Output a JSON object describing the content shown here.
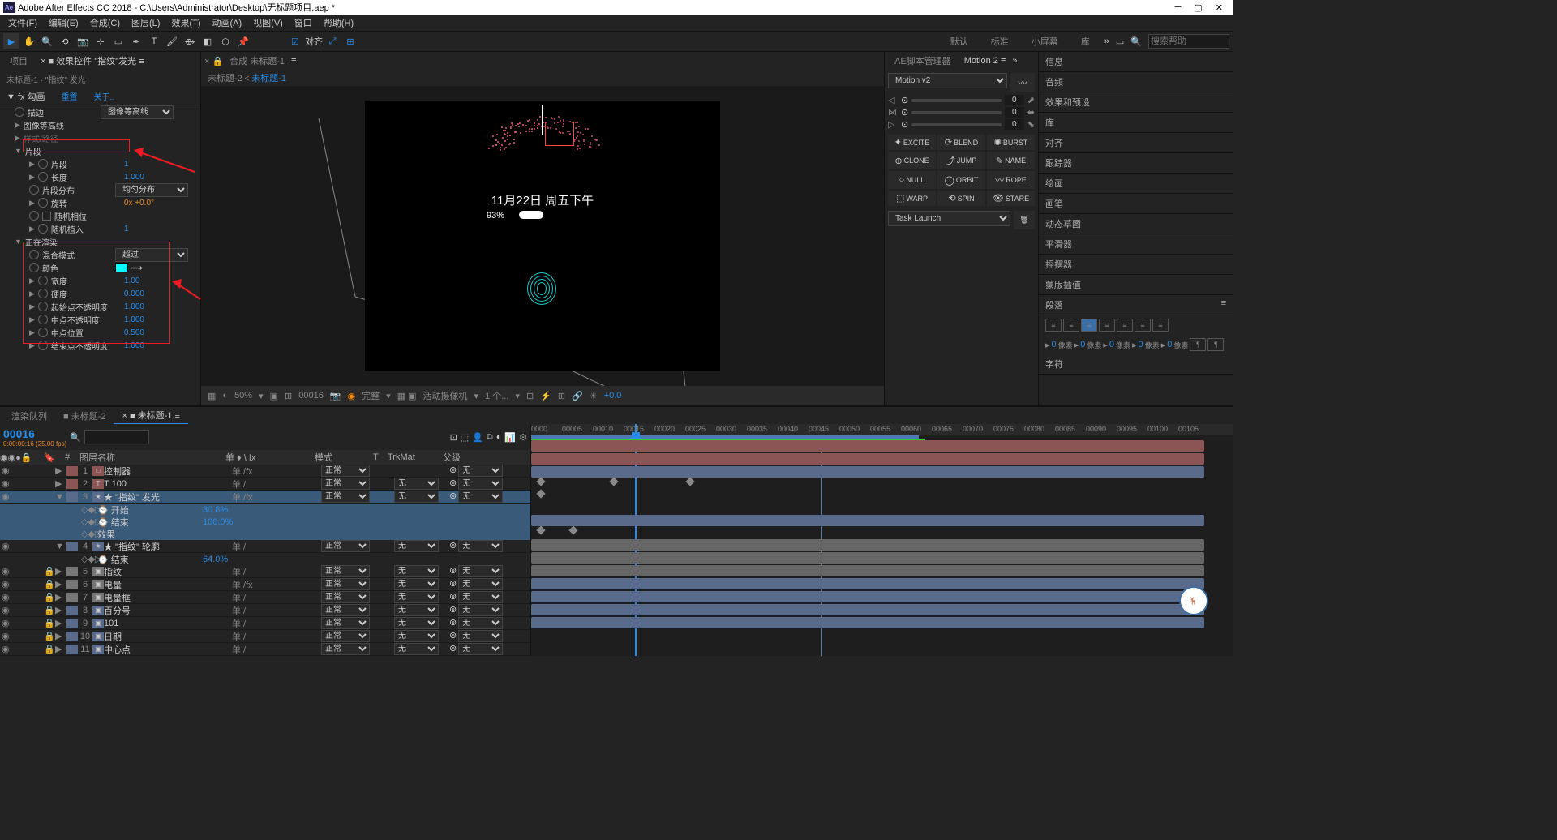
{
  "title": "Adobe After Effects CC 2018 - C:\\Users\\Administrator\\Desktop\\无标题项目.aep *",
  "menu": [
    "文件(F)",
    "编辑(E)",
    "合成(C)",
    "图层(L)",
    "效果(T)",
    "动画(A)",
    "视图(V)",
    "窗口",
    "帮助(H)"
  ],
  "align": "对齐",
  "workspaces": [
    "默认",
    "标准",
    "小屏幕",
    "库"
  ],
  "search_help": "搜索帮助",
  "left_tabs": {
    "project": "项目",
    "effect_controls": "效果控件 \"指纹\"发光"
  },
  "effect_layer": "未标题-1 · \"指纹\" 发光",
  "effect_name": "勾画",
  "reset": "重置",
  "about": "关于..",
  "props": {
    "stroke": "描边",
    "stroke_val": "图像等高线",
    "image_contours": "图像等高线",
    "pattern": "样式/路径",
    "segments_group": "片段",
    "segments": "片段",
    "segments_val": "1",
    "length": "长度",
    "length_val": "1.000",
    "dist": "片段分布",
    "dist_val": "均匀分布",
    "rotation": "旋转",
    "rotation_val": "0x +0.0°",
    "random_phase": "随机相位",
    "random_seed": "随机植入",
    "random_seed_val": "1",
    "rendering": "正在渲染",
    "blend": "混合模式",
    "blend_val": "超过",
    "color": "颜色",
    "width": "宽度",
    "width_val": "1.00",
    "hardness": "硬度",
    "hardness_val": "0.000",
    "start_op": "起始点不透明度",
    "start_op_val": "1.000",
    "mid_op": "中点不透明度",
    "mid_op_val": "1.000",
    "mid_pos": "中点位置",
    "mid_pos_val": "0.500",
    "end_op": "结束点不透明度",
    "end_op_val": "1.000"
  },
  "comp_tabs": {
    "composition": "合成 未标题-1"
  },
  "crumb1": "未标题-2",
  "crumb2": "未标题-1",
  "canvas": {
    "date": "11月22日 周五下午",
    "progress": "93%"
  },
  "viewer": {
    "zoom": "50%",
    "frame": "00016",
    "quality": "完整",
    "camera": "活动摄像机",
    "views": "1 个...",
    "exp": "+0.0"
  },
  "script_mgr": "AE脚本管理器",
  "motion_tab": "Motion 2",
  "motion_ver": "Motion v2",
  "motion_btns": [
    "EXCITE",
    "BLEND",
    "BURST",
    "CLONE",
    "JUMP",
    "NAME",
    "NULL",
    "ORBIT",
    "ROPE",
    "WARP",
    "SPIN",
    "STARE"
  ],
  "task": "Task Launch",
  "right_panels": [
    "信息",
    "音频",
    "效果和预设",
    "库",
    "对齐",
    "跟踪器",
    "绘画",
    "画笔",
    "动态草图",
    "平滑器",
    "摇摆器",
    "蒙版插值",
    "段落",
    "字符"
  ],
  "pixel_labels": [
    "像素",
    "像素",
    "像素",
    "像素",
    "像素"
  ],
  "tl_tabs": {
    "render": "渲染队列",
    "comp2": "未标题-2",
    "comp1": "未标题-1"
  },
  "tc": "00016",
  "tc_sub": "0:00:00:16 (25.00 fps)",
  "cols": {
    "name": "图层名称",
    "switches": "单 ♦ \\ fx",
    "mode": "模式",
    "t": "T",
    "trk": "TrkMat",
    "parent": "父级"
  },
  "mode_normal": "正常",
  "none": "无",
  "layers": [
    {
      "n": 1,
      "name": "控制器",
      "lbl": "#8b5555",
      "icon": "□",
      "sw": "单 /fx"
    },
    {
      "n": 2,
      "name": "T 100",
      "lbl": "#8b5555",
      "icon": "T",
      "sw": "单 /"
    },
    {
      "n": 3,
      "name": "★ \"指纹\" 发光",
      "lbl": "#5a6a8a",
      "icon": "★",
      "sw": "单 /fx",
      "sel": true,
      "sub": [
        {
          "name": "⌚ 开始",
          "val": "30.8%"
        },
        {
          "name": "⌚ 结束",
          "val": "100.0%"
        },
        {
          "name": "效果",
          "val": ""
        }
      ]
    },
    {
      "n": 4,
      "name": "★ \"指纹\" 轮廓",
      "lbl": "#5a6a8a",
      "icon": "★",
      "sw": "单 /",
      "sub": [
        {
          "name": "⌚ 结束",
          "val": "64.0%"
        }
      ]
    },
    {
      "n": 5,
      "name": "指纹",
      "lbl": "#777",
      "lock": true,
      "sw": "单 /"
    },
    {
      "n": 6,
      "name": "电量",
      "lbl": "#777",
      "lock": true,
      "sw": "单 /fx"
    },
    {
      "n": 7,
      "name": "电量框",
      "lbl": "#777",
      "lock": true,
      "sw": "单 /"
    },
    {
      "n": 8,
      "name": "百分号",
      "lbl": "#5a6a8a",
      "lock": true,
      "sw": "单 /"
    },
    {
      "n": 9,
      "name": "101",
      "lbl": "#5a6a8a",
      "lock": true,
      "sw": "单 /"
    },
    {
      "n": 10,
      "name": "日期",
      "lbl": "#5a6a8a",
      "lock": true,
      "sw": "单 /"
    },
    {
      "n": 11,
      "name": "中心点",
      "lbl": "#5a6a8a",
      "lock": true,
      "sw": "单 /"
    }
  ],
  "ruler": [
    "0000",
    "00005",
    "00010",
    "00015",
    "00020",
    "00025",
    "00030",
    "00035",
    "00040",
    "00045",
    "00050",
    "00055",
    "00060",
    "00065",
    "00070",
    "00075",
    "00080",
    "00085",
    "00090",
    "00095",
    "00100",
    "00105"
  ]
}
